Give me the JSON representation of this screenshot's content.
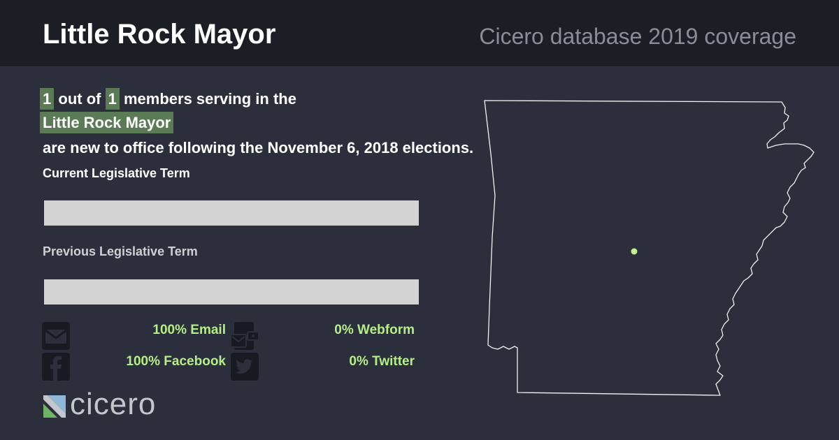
{
  "header": {
    "title": "Little Rock Mayor",
    "subtitle": "Cicero database 2019 coverage"
  },
  "summary": {
    "new_count": "1",
    "text_out_of": "out of",
    "total_count": "1",
    "text_members": "members serving in the",
    "body_name": "Little Rock Mayor",
    "text_rest": "are new to office following the November 6, 2018 elections."
  },
  "terms": {
    "current_label": "Current Legislative Term",
    "previous_label": "Previous Legislative Term"
  },
  "stats": {
    "email": "100% Email",
    "webform": "0% Webform",
    "facebook": "100% Facebook",
    "twitter": "0% Twitter"
  },
  "icons": {
    "email": "envelope-icon",
    "webform": "webform-icon",
    "facebook": "facebook-icon",
    "twitter": "twitter-icon"
  },
  "logo": {
    "text": "cicero"
  },
  "colors": {
    "background": "#2b2e3b",
    "header": "#1c1e26",
    "highlight": "#5b7a56",
    "stat_text": "#b5ed88",
    "bar": "#d3d3d3",
    "marker": "#c5f08f"
  }
}
